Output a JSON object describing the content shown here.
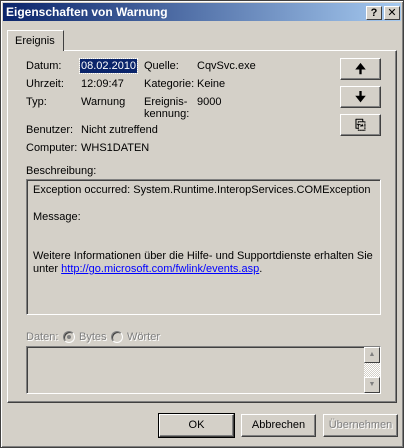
{
  "window": {
    "title": "Eigenschaften von Warnung",
    "help_glyph": "?",
    "close_glyph": "✕"
  },
  "tabs": [
    {
      "label": "Ereignis"
    }
  ],
  "fields": {
    "datum_label": "Datum:",
    "datum_value": "08.02.2010",
    "quelle_label": "Quelle:",
    "quelle_value": "CqvSvc.exe",
    "uhrzeit_label": "Uhrzeit:",
    "uhrzeit_value": "12:09:47",
    "kategorie_label": "Kategorie:",
    "kategorie_value": "Keine",
    "typ_label": "Typ:",
    "typ_value": "Warnung",
    "kennung_label_line1": "Ereignis-",
    "kennung_label_line2": "kennung:",
    "kennung_value": "9000",
    "benutzer_label": "Benutzer:",
    "benutzer_value": "Nicht zutreffend",
    "computer_label": "Computer:",
    "computer_value": "WHS1DATEN"
  },
  "side_buttons": {
    "up_glyph": "🠉",
    "down_glyph": "🠋",
    "copy_glyph": "⎘"
  },
  "description": {
    "label": "Beschreibung:",
    "line1": "Exception occurred:  System.Runtime.InteropServices.COMException",
    "line2": "Message:",
    "line3": "Weitere Informationen über die Hilfe- und Supportdienste erhalten Sie",
    "line4_prefix": "unter ",
    "link": "http://go.microsoft.com/fwlink/events.asp",
    "line4_suffix": "."
  },
  "data_section": {
    "label": "Daten:",
    "bytes_label": "Bytes",
    "words_label": "Wörter",
    "selected": "Bytes"
  },
  "buttons": {
    "ok": "OK",
    "cancel": "Abbrechen",
    "apply": "Übernehmen"
  }
}
